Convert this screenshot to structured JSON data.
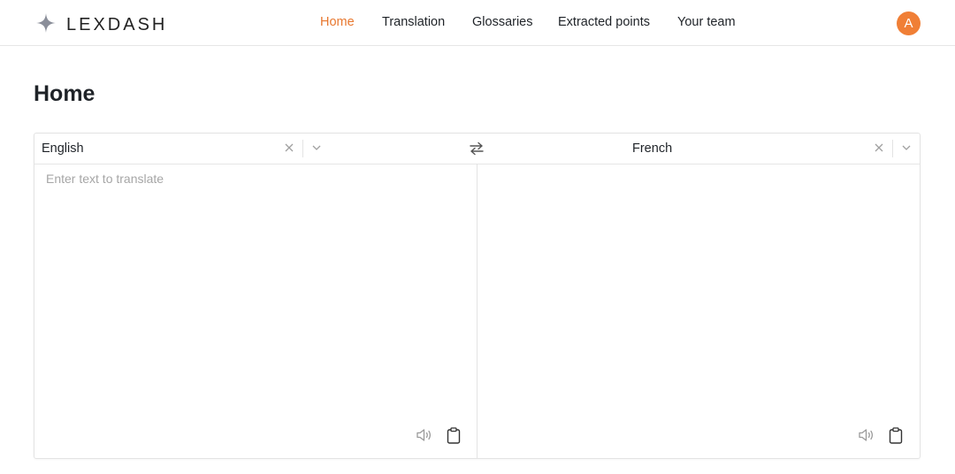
{
  "brand": {
    "name": "LEXDASH",
    "logo_icon": "sparkle-icon"
  },
  "nav": {
    "items": [
      {
        "label": "Home",
        "active": true
      },
      {
        "label": "Translation",
        "active": false
      },
      {
        "label": "Glossaries",
        "active": false
      },
      {
        "label": "Extracted points",
        "active": false
      },
      {
        "label": "Your team",
        "active": false
      }
    ],
    "accent_color": "#e8772e"
  },
  "user": {
    "avatar_initial": "A",
    "avatar_color": "#f07f36"
  },
  "page": {
    "title": "Home"
  },
  "translator": {
    "source_language": "English",
    "target_language": "French",
    "source_placeholder": "Enter text to translate",
    "source_text": "",
    "target_text": ""
  }
}
